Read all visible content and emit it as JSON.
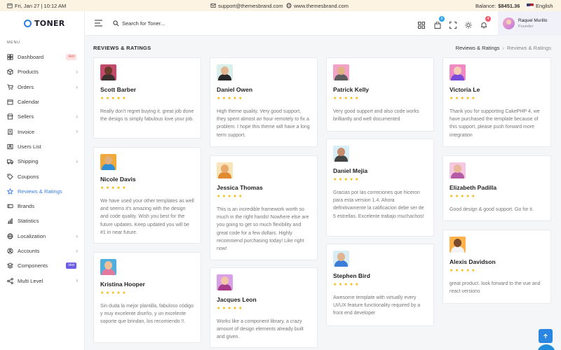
{
  "topbar": {
    "date": "Fri, Jan 27 | 10:12 AM",
    "email": "support@themesbrand.com",
    "website": "www.themesbrand.com",
    "balance_label": "Balance:",
    "balance_value": "$8451.36",
    "language": "English"
  },
  "brand": {
    "name": "TONER"
  },
  "sidebar": {
    "caption": "MENU",
    "items": [
      {
        "label": "Dashboard",
        "icon": "dashboard-icon",
        "badge": "Hot"
      },
      {
        "label": "Products",
        "icon": "box-icon",
        "chevron": true
      },
      {
        "label": "Orders",
        "icon": "cart-icon",
        "chevron": true
      },
      {
        "label": "Calendar",
        "icon": "calendar-icon"
      },
      {
        "label": "Sellers",
        "icon": "store-icon",
        "chevron": true
      },
      {
        "label": "Invoice",
        "icon": "invoice-icon",
        "chevron": true
      },
      {
        "label": "Users List",
        "icon": "users-icon"
      },
      {
        "label": "Shipping",
        "icon": "truck-icon",
        "chevron": true
      },
      {
        "label": "Coupons",
        "icon": "tag-icon"
      },
      {
        "label": "Reviews & Ratings",
        "icon": "star-icon",
        "active": true
      },
      {
        "label": "Brands",
        "icon": "brands-icon"
      },
      {
        "label": "Statistics",
        "icon": "chart-icon"
      },
      {
        "label": "Localization",
        "icon": "globe-icon",
        "chevron": true
      },
      {
        "label": "Accounts",
        "icon": "account-icon",
        "chevron": true
      },
      {
        "label": "Components",
        "icon": "layers-icon",
        "badge": "Hot"
      },
      {
        "label": "Multi Level",
        "icon": "share-icon",
        "chevron": true
      }
    ]
  },
  "header": {
    "search_placeholder": "Search for Toner...",
    "cart_count": "6",
    "notification_count": "4",
    "user_name": "Raquel Murillo",
    "user_role": "Founder"
  },
  "page": {
    "title": "REVIEWS & RATINGS",
    "breadcrumb": [
      "Reviews & Ratings",
      "Reviews & Ratings"
    ]
  },
  "colors": {
    "accent": "#3b7de8",
    "star": "#f4b400",
    "hot_red": "#e0585d",
    "hot_purple": "#6c5ce7"
  },
  "reviews": [
    {
      "name": "Scott Barber",
      "stars": "★★★★★",
      "text": "Really don't regret buying it. great job done the design is simply fabulous love your job."
    },
    {
      "name": "Nicole Davis",
      "stars": "★★★★★",
      "text": "We have used your other templates as well and seems it's amazing with the design and code quality. Wish you best for the future updates. Keep updated you will be #1 in near future."
    },
    {
      "name": "Kristina Hooper",
      "stars": "★★★★★",
      "text": "Sin duda la mejor plantilla, fabuloso código y muy excelente diseño, y un excelente soporte que brindan, los recomiendo !!."
    },
    {
      "name": "Daniel Owen",
      "stars": "★★★★★",
      "text": "High theme quality. Very good support, they spent almost an hour remotely to fix a problem. I hope this theme will have a long term support."
    },
    {
      "name": "Jessica Thomas",
      "stars": "★★★★★",
      "text": "This is an incredible framework worth so much in the right hands! Nowhere else are you going to get so much flexibility and great code for a few dollars. Highly recommend purchasing today! Like right now!"
    },
    {
      "name": "Jacques Leon",
      "stars": "★★★★★",
      "text": "Works like a component library, a crazy amount of design elements already built and given."
    },
    {
      "name": "Patrick Kelly",
      "stars": "★★★★★",
      "text": "Very good support and also code works brilliantly and well documented"
    },
    {
      "name": "Daniel Mejia",
      "stars": "★★★★★",
      "text": "Gracias por las correciones que hiceron para esta version 1.4. Ahora definitivamente la calificacion debe ser de 5 estrellas. Excelente trabajo muchachos!"
    },
    {
      "name": "Stephen Bird",
      "stars": "★★★★★",
      "text": "Awesome template with virtually every UI/UX feature functionality required by a front end developer"
    },
    {
      "name": "Victoria Le",
      "stars": "★★★★★",
      "text": "Thank you for supporting CakePHP 4, we have purchased the template because of this support, please push forward more integration"
    },
    {
      "name": "Elizabeth Padilla",
      "stars": "★★★★★",
      "text": "Good design & good support. Go for it."
    },
    {
      "name": "Alexis Davidson",
      "stars": "★★★★★",
      "text": "great product. look forward to the vue and react versions"
    }
  ]
}
